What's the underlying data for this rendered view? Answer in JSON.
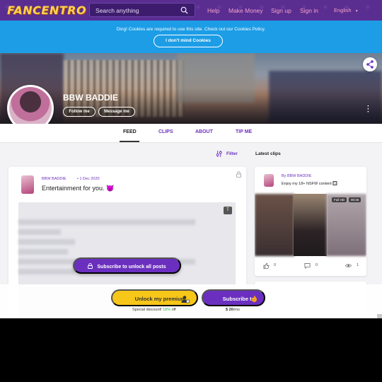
{
  "nav": {
    "logo": "FANCENTRO",
    "search_placeholder": "Search anything",
    "links": [
      "Help",
      "Make Money",
      "Sign up",
      "Sign in"
    ],
    "language": "English",
    "bg_color": "#5a2d91",
    "link_color": "#f5a3c7"
  },
  "cookie": {
    "message": "Ding! Cookies are required to use this site. Check out our Cookies Policy.",
    "button": "I don't mind Cookies",
    "bg_color": "#1c9de6"
  },
  "profile": {
    "name": "BBW BADDIE",
    "follow": "Follow me",
    "message": "Message me"
  },
  "tabs": [
    {
      "label": "FEED",
      "active": true
    },
    {
      "label": "CLIPS",
      "active": false
    },
    {
      "label": "ABOUT",
      "active": false
    },
    {
      "label": "TIP ME",
      "active": false
    }
  ],
  "feed": {
    "filter": "Filter",
    "post": {
      "author": "BBW BADDIE",
      "date": "1 Dec 2020",
      "title": "Entertainment for you. 😈",
      "type_badge": "T",
      "unlock_button": "Subscribe to unlock all posts"
    }
  },
  "sidebar": {
    "heading": "Latest clips",
    "clip": {
      "by": "By BBW BADDIE",
      "description": "Enjoy my 18+ NSFW content 🔲",
      "hd_badge": "Full HD",
      "duration": "00:45",
      "likes": "0",
      "comments": "0",
      "views": "1"
    }
  },
  "bottom": {
    "premium_button": "Unlock my premium",
    "subscribe_button": "Subscribe to",
    "discount_prefix": "Special discount!",
    "discount_pct": "18%",
    "discount_suffix": "off",
    "price_value": "$ 20",
    "price_period": "/mo",
    "accent_purple": "#6b2fbf",
    "accent_yellow": "#f6c619"
  }
}
